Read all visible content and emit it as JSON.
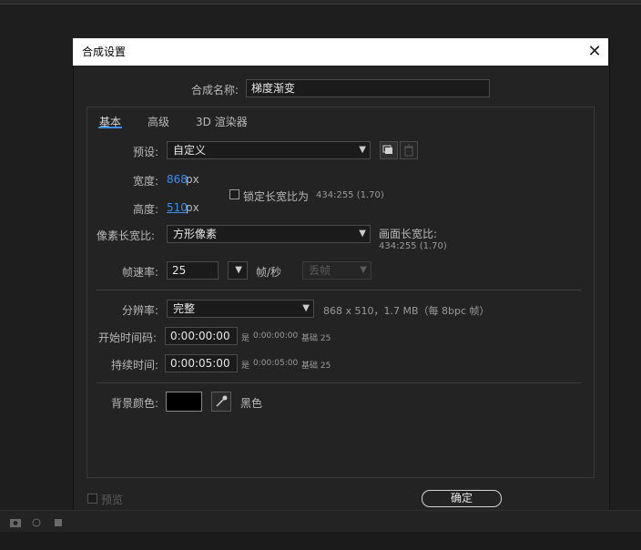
{
  "window": {
    "title": "合成设置",
    "close_glyph": "✕"
  },
  "comp_name": {
    "label": "合成名称:",
    "value": "梯度渐变"
  },
  "tabs": [
    {
      "label": "基本",
      "active": true
    },
    {
      "label": "高级",
      "active": false
    },
    {
      "label": "3D 渲染器",
      "active": false
    }
  ],
  "preset": {
    "label": "预设:",
    "value": "自定义"
  },
  "width": {
    "label": "宽度:",
    "value": "868",
    "unit": "px"
  },
  "height": {
    "label": "高度:",
    "value": "510",
    "unit": "px"
  },
  "lock_aspect": {
    "label": "锁定长宽比为",
    "ratio": "434:255 (1.70)"
  },
  "pixel_aspect": {
    "label": "像素长宽比:",
    "value": "方形像素"
  },
  "frame_aspect": {
    "label": "画面长宽比:",
    "value": "434:255 (1.70)"
  },
  "frame_rate": {
    "label": "帧速率:",
    "value": "25",
    "unit": "帧/秒",
    "drop_frame": "丢帧"
  },
  "resolution": {
    "label": "分辨率:",
    "value": "完整",
    "info": "868 x 510，1.7 MB（每 8bpc 帧）"
  },
  "start_timecode": {
    "label": "开始时间码:",
    "value": "0:00:00:00",
    "equiv_prefix": "是",
    "equiv": "0:00:00:00",
    "base": "基础 25"
  },
  "duration": {
    "label": "持续时间:",
    "value": "0:00:05:00",
    "equiv_prefix": "是",
    "equiv": "0:00:05:00",
    "base": "基础 25"
  },
  "background": {
    "label": "背景颜色:",
    "color_name": "黑色",
    "swatch": "#000000"
  },
  "footer": {
    "preview_label": "预览",
    "ok_label": "确定"
  },
  "colors": {
    "accent": "#3d8ee8",
    "dialog_bg": "#232323",
    "titlebar_bg": "#ffffff"
  }
}
